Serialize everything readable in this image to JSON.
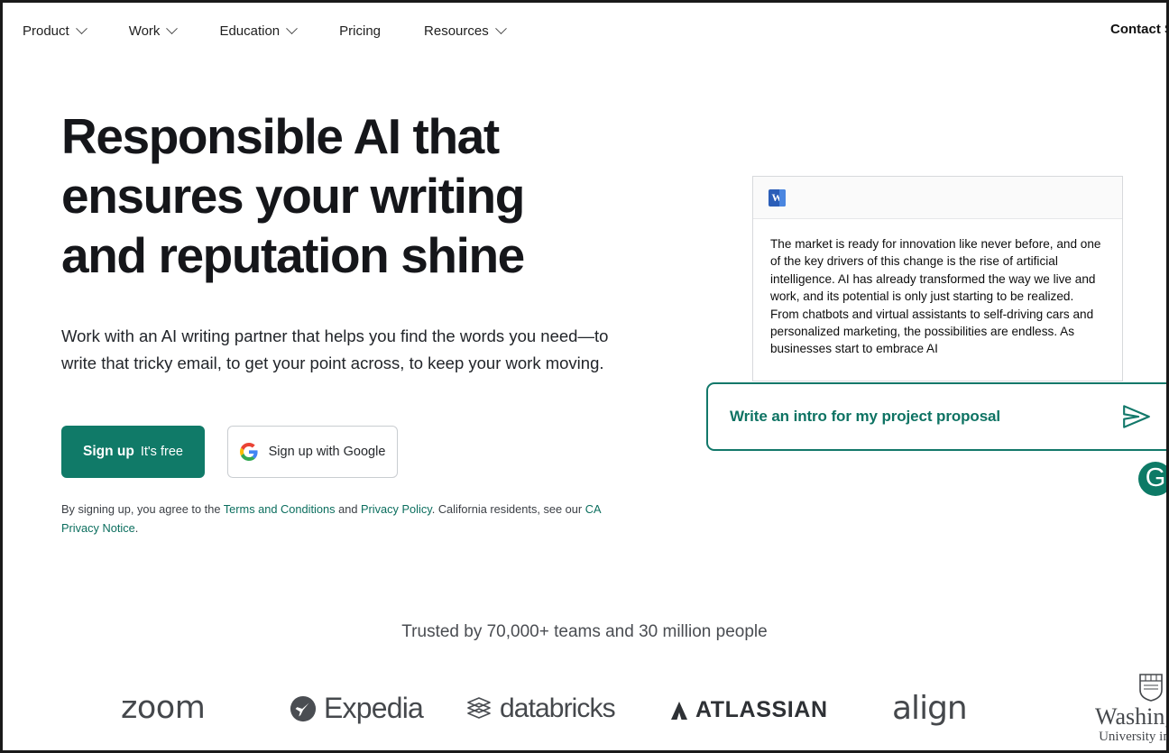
{
  "nav": {
    "items": [
      {
        "label": "Product",
        "has_dropdown": true
      },
      {
        "label": "Work",
        "has_dropdown": true
      },
      {
        "label": "Education",
        "has_dropdown": true
      },
      {
        "label": "Pricing",
        "has_dropdown": false
      },
      {
        "label": "Resources",
        "has_dropdown": true
      }
    ],
    "right_link": "Contact S"
  },
  "hero": {
    "headline": "Responsible AI that ensures your writing and reputation shine",
    "subhead": "Work with an AI writing partner that helps you find the words you need—to write that tricky email, to get your point across, to keep your work moving.",
    "signup_button": {
      "strong": "Sign up",
      "light": "It's free"
    },
    "google_button": {
      "label": "Sign up with Google",
      "icon": "google-g-icon"
    },
    "legal": {
      "part1": "By signing up, you agree to the ",
      "terms_link": "Terms and Conditions",
      "part2": " and ",
      "privacy_link": "Privacy Policy",
      "part3": ". California residents, see our ",
      "ca_link": "CA Privacy Notice",
      "part4": "."
    }
  },
  "document_card": {
    "app_icon": "microsoft-word-icon",
    "body_text": "The market is ready for innovation like never before, and one of the key drivers of this change is the rise of artificial intelligence. AI has already transformed the way we live and work, and its potential is only just starting to be realized. From chatbots and virtual assistants to self-driving cars and personalized marketing, the possibilities are endless. As businesses start to embrace AI"
  },
  "prompt_box": {
    "text": "Write an intro for my project proposal",
    "send_icon": "send-paper-plane-icon",
    "border_color": "#12786a",
    "text_color": "#0e7363"
  },
  "grammarly_badge": {
    "glyph": "G",
    "color": "#0d7a66"
  },
  "trusted": {
    "text": "Trusted by 70,000+ teams and 30 million people"
  },
  "logos": [
    {
      "name": "zoom",
      "text": "zoom"
    },
    {
      "name": "expedia",
      "text": "Expedia"
    },
    {
      "name": "databricks",
      "text": "databricks"
    },
    {
      "name": "atlassian",
      "text": "ATLASSIAN"
    },
    {
      "name": "align",
      "text": "align"
    },
    {
      "name": "washu",
      "text": "Washington",
      "subtext": "University in St.Lo"
    }
  ],
  "colors": {
    "brand_teal": "#107a68",
    "headline": "#15161a",
    "link": "#0b6e5e"
  }
}
